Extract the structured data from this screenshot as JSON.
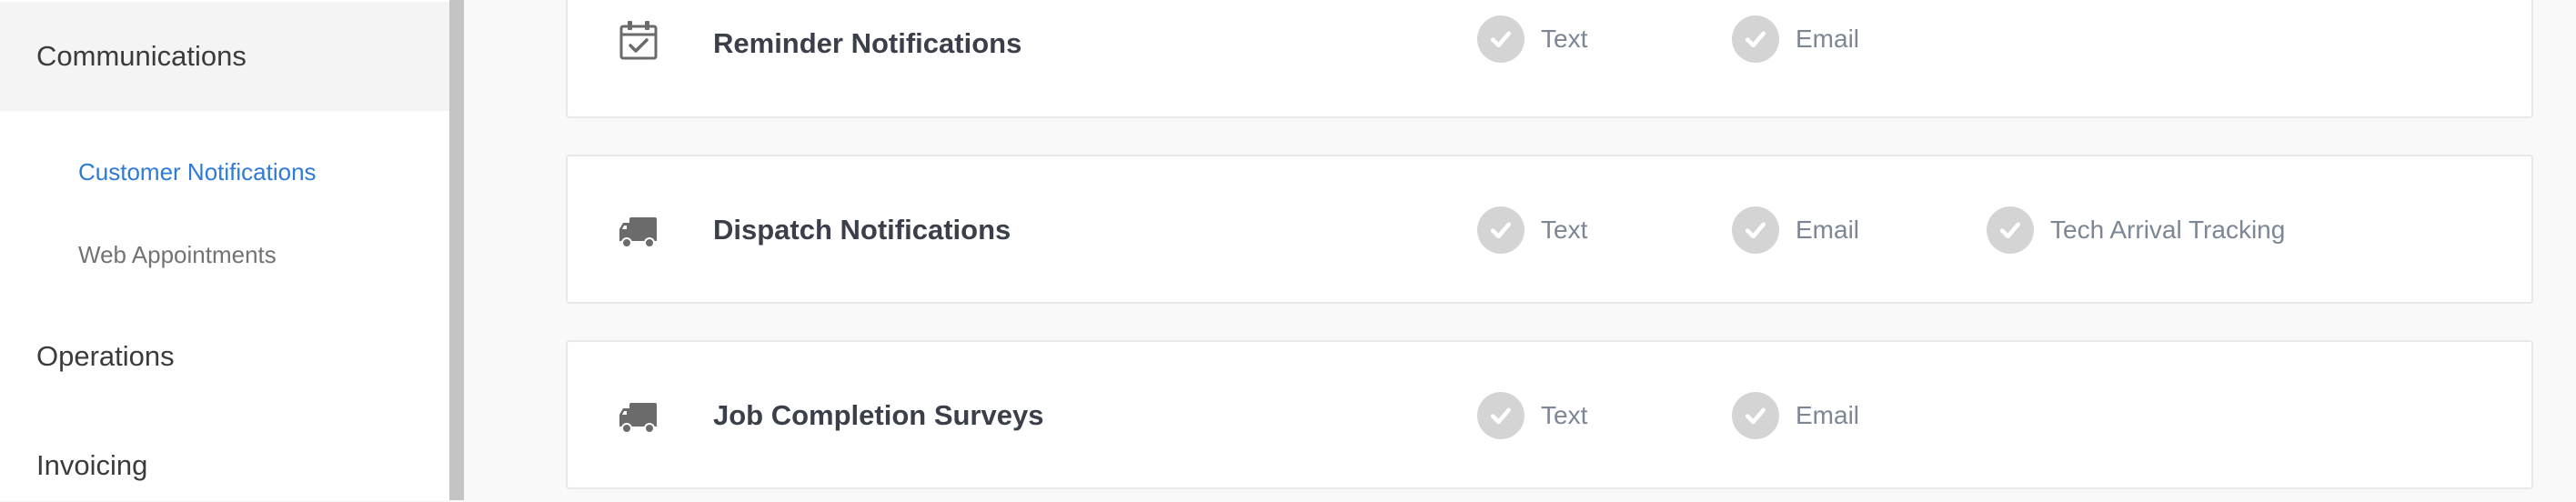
{
  "sidebar": {
    "communications": "Communications",
    "customer_notifications": "Customer Notifications",
    "web_appointments": "Web Appointments",
    "operations": "Operations",
    "invoicing": "Invoicing"
  },
  "rows": [
    {
      "title": "Reminder Notifications",
      "icon": "calendar-check-icon",
      "options": [
        "Text",
        "Email"
      ]
    },
    {
      "title": "Dispatch Notifications",
      "icon": "truck-icon",
      "options": [
        "Text",
        "Email",
        "Tech Arrival Tracking"
      ]
    },
    {
      "title": "Job Completion Surveys",
      "icon": "truck-icon",
      "options": [
        "Text",
        "Email"
      ]
    }
  ],
  "colors": {
    "accent": "#2f7ad6",
    "check_bg": "#d4d4d4",
    "rail": "#c4c4c4"
  }
}
